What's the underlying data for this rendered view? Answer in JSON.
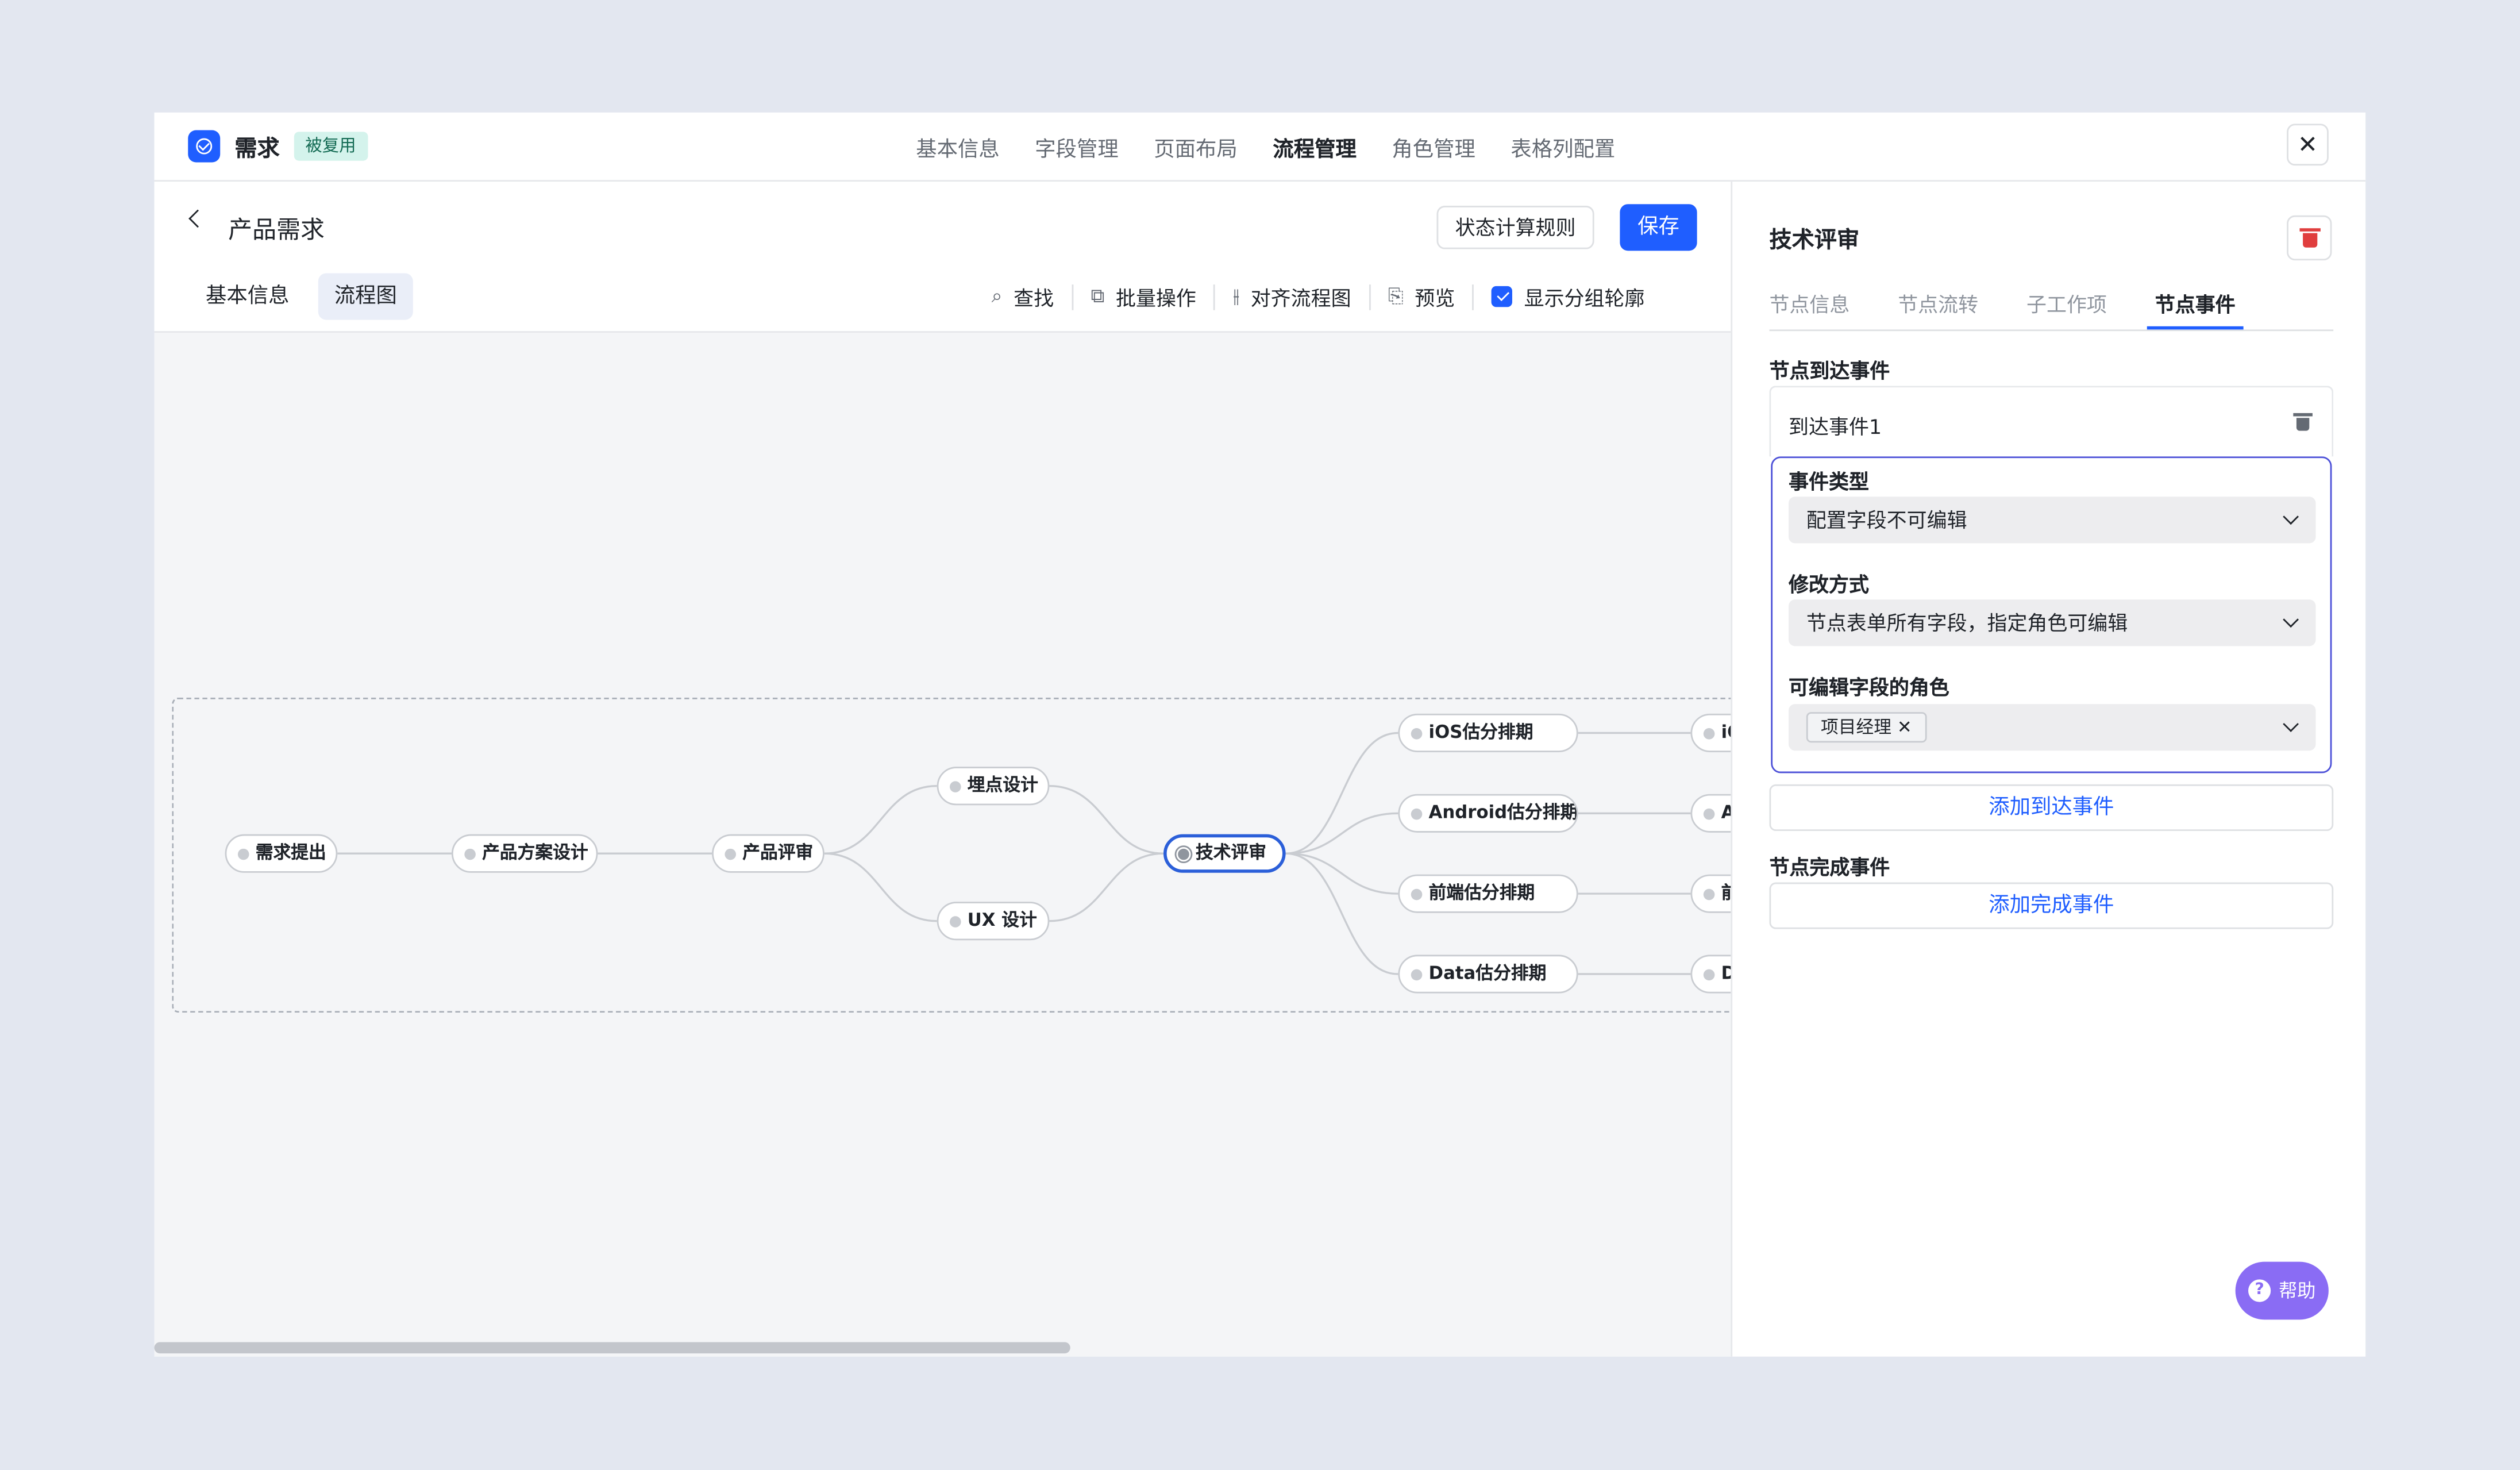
{
  "header": {
    "app_title": "需求",
    "badge": "被复用",
    "tabs": [
      {
        "label": "基本信息",
        "active": false
      },
      {
        "label": "字段管理",
        "active": false
      },
      {
        "label": "页面布局",
        "active": false
      },
      {
        "label": "流程管理",
        "active": true
      },
      {
        "label": "角色管理",
        "active": false
      },
      {
        "label": "表格列配置",
        "active": false
      }
    ],
    "close_icon": "close-icon"
  },
  "workflow": {
    "back_icon": "chevron-left-icon",
    "title": "产品需求",
    "state_rule_button": "状态计算规则",
    "save_button": "保存",
    "view_tabs": [
      {
        "label": "基本信息",
        "active": false
      },
      {
        "label": "流程图",
        "active": true
      }
    ],
    "toolbar": {
      "find": "查找",
      "batch": "批量操作",
      "align": "对齐流程图",
      "preview": "预览",
      "show_groups": "显示分组轮廓",
      "show_groups_checked": true
    }
  },
  "flow": {
    "nodes": [
      {
        "id": "n1",
        "label": "需求提出"
      },
      {
        "id": "n2",
        "label": "产品方案设计"
      },
      {
        "id": "n3",
        "label": "产品评审"
      },
      {
        "id": "n4",
        "label": "埋点设计"
      },
      {
        "id": "n5",
        "label": "UX 设计"
      },
      {
        "id": "n6",
        "label": "技术评审",
        "selected": true
      },
      {
        "id": "n7",
        "label": "iOS估分排期"
      },
      {
        "id": "n8",
        "label": "Android估分排期"
      },
      {
        "id": "n9",
        "label": "前端估分排期"
      },
      {
        "id": "n10",
        "label": "Data估分排期"
      },
      {
        "id": "n11",
        "label": "iO"
      },
      {
        "id": "n12",
        "label": "A"
      },
      {
        "id": "n13",
        "label": "前"
      },
      {
        "id": "n14",
        "label": "D"
      }
    ],
    "edges": [
      [
        "n1",
        "n2"
      ],
      [
        "n2",
        "n3"
      ],
      [
        "n3",
        "n4"
      ],
      [
        "n3",
        "n5"
      ],
      [
        "n4",
        "n6"
      ],
      [
        "n5",
        "n6"
      ],
      [
        "n6",
        "n7"
      ],
      [
        "n6",
        "n8"
      ],
      [
        "n6",
        "n9"
      ],
      [
        "n6",
        "n10"
      ],
      [
        "n7",
        "n11"
      ],
      [
        "n8",
        "n12"
      ],
      [
        "n9",
        "n13"
      ],
      [
        "n10",
        "n14"
      ]
    ]
  },
  "panel": {
    "title": "技术评审",
    "tabs": [
      {
        "label": "节点信息",
        "active": false
      },
      {
        "label": "节点流转",
        "active": false
      },
      {
        "label": "子工作项",
        "active": false
      },
      {
        "label": "节点事件",
        "active": true
      }
    ],
    "arrival_section": "节点到达事件",
    "event_name": "到达事件1",
    "event_type_label": "事件类型",
    "event_type_value": "配置字段不可编辑",
    "modify_label": "修改方式",
    "modify_value": "节点表单所有字段，指定角色可编辑",
    "roles_label": "可编辑字段的角色",
    "role_tag": "项目经理",
    "add_arrival": "添加到达事件",
    "complete_section": "节点完成事件",
    "add_complete": "添加完成事件"
  },
  "help": {
    "label": "帮助",
    "icon": "help-icon"
  },
  "colors": {
    "primary": "#1f5eff",
    "selected_node": "#2b5fd9",
    "config_border": "#4d51d8",
    "danger": "#e03e3e",
    "help": "#8a6cf4"
  }
}
